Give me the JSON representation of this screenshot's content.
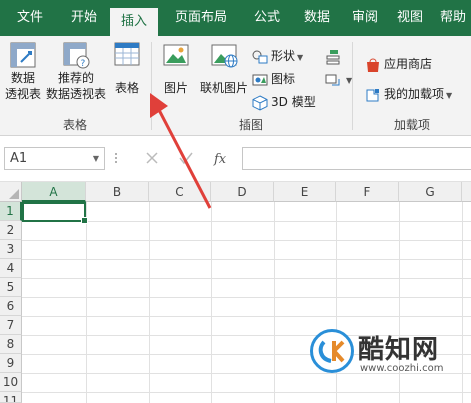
{
  "ribbon": {
    "tabs": [
      {
        "label": "文件",
        "active": false
      },
      {
        "label": "开始",
        "active": false
      },
      {
        "label": "插入",
        "active": true
      },
      {
        "label": "页面布局",
        "active": false
      },
      {
        "label": "公式",
        "active": false
      },
      {
        "label": "数据",
        "active": false
      },
      {
        "label": "审阅",
        "active": false
      },
      {
        "label": "视图",
        "active": false
      },
      {
        "label": "帮助",
        "active": false
      }
    ],
    "tables_group": {
      "label": "表格",
      "pivot_line1": "数据",
      "pivot_line2": "透视表",
      "recommended_line1": "推荐的",
      "recommended_line2": "数据透视表",
      "table_label": "表格"
    },
    "illustrations_group": {
      "label": "插图",
      "picture_label": "图片",
      "online_picture_label": "联机图片",
      "shapes_label": "形状",
      "icons_label": "图标",
      "model3d_label": "3D 模型"
    },
    "addins_group": {
      "label": "加载项",
      "store_label": "应用商店",
      "my_addins_label": "我的加载项"
    }
  },
  "formula_bar": {
    "name_box": "A1",
    "formula": ""
  },
  "grid": {
    "columns": [
      "A",
      "B",
      "C",
      "D",
      "E",
      "F",
      "G"
    ],
    "rows": [
      "1",
      "2",
      "3",
      "4",
      "5",
      "6",
      "7",
      "8",
      "9",
      "10",
      "11"
    ],
    "active_cell": "A1"
  },
  "watermark": {
    "title": "酷知网",
    "url": "www.coozhi.com"
  },
  "colors": {
    "ribbon_green": "#217346",
    "ribbon_bg": "#f3f3f3",
    "annotation_arrow": "#e0403a"
  }
}
